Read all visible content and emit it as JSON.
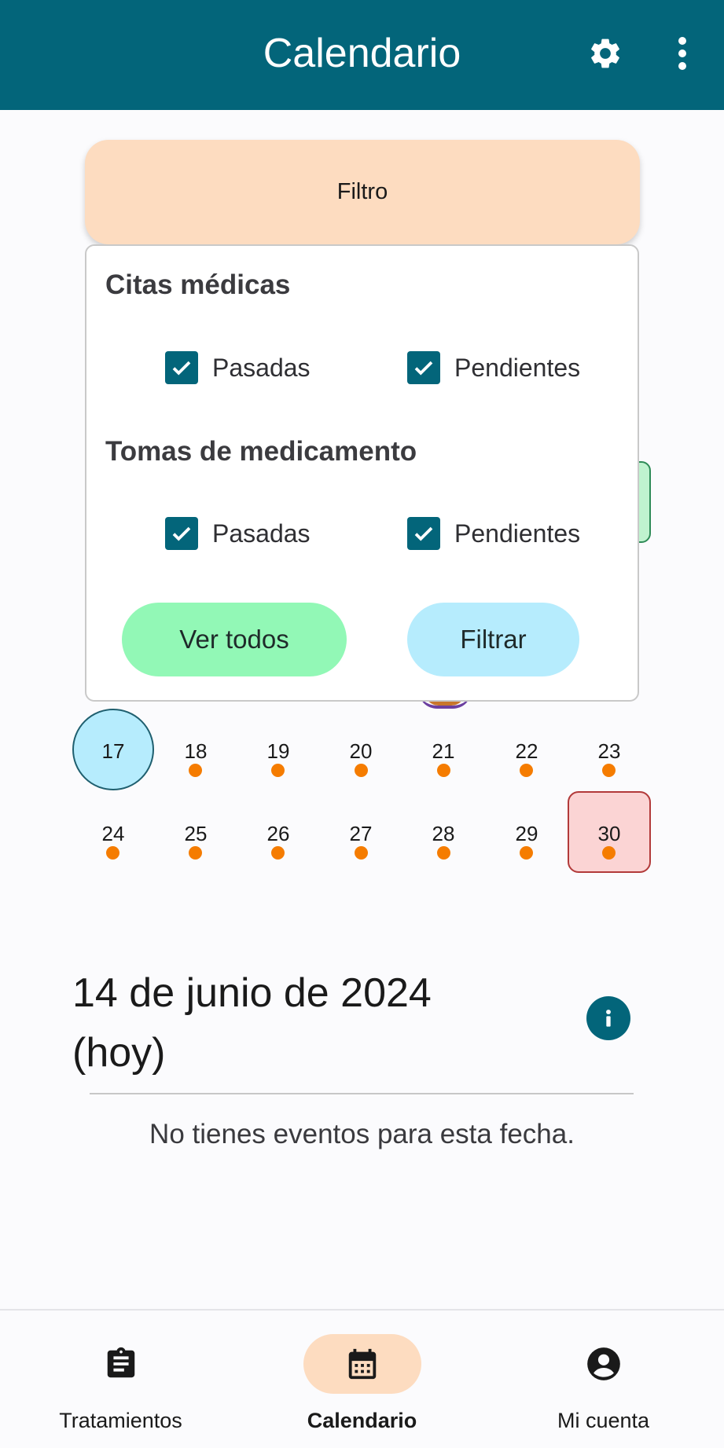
{
  "appbar": {
    "title": "Calendario",
    "settings_icon": "gear-icon",
    "more_icon": "more-vert-icon",
    "color": "#03657a"
  },
  "filter_button": {
    "label": "Filtro"
  },
  "filter_panel": {
    "section1": {
      "title": "Citas médicas",
      "options": [
        {
          "label": "Pasadas",
          "checked": true
        },
        {
          "label": "Pendientes",
          "checked": true
        }
      ]
    },
    "section2": {
      "title": "Tomas de medicamento",
      "options": [
        {
          "label": "Pasadas",
          "checked": true
        },
        {
          "label": "Pendientes",
          "checked": true
        }
      ]
    },
    "view_all_label": "Ver todos",
    "apply_label": "Filtrar"
  },
  "calendar": {
    "weeks": [
      {
        "days": [
          "17",
          "18",
          "19",
          "20",
          "21",
          "22",
          "23"
        ]
      },
      {
        "days": [
          "24",
          "25",
          "26",
          "27",
          "28",
          "29",
          "30"
        ]
      }
    ],
    "highlighted_day": "17",
    "selected_day": "30",
    "event_dot_color": "#f57c00"
  },
  "date_heading": {
    "line1": "14 de junio de 2024",
    "line2": "(hoy)",
    "info_icon": "info-icon"
  },
  "empty_message": "No tienes eventos para esta fecha.",
  "bottom_nav": {
    "items": [
      {
        "label": "Tratamientos",
        "icon": "clipboard-icon",
        "active": false
      },
      {
        "label": "Calendario",
        "icon": "calendar-icon",
        "active": true
      },
      {
        "label": "Mi cuenta",
        "icon": "account-circle-icon",
        "active": false
      }
    ]
  }
}
